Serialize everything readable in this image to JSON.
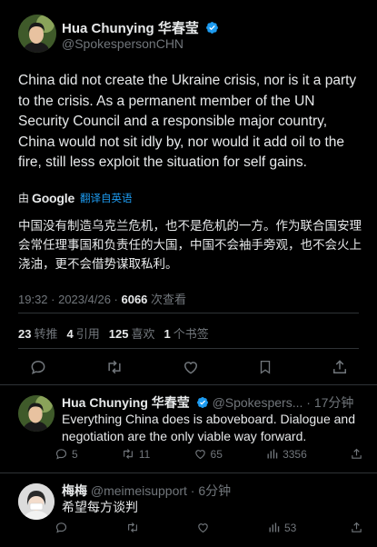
{
  "main_tweet": {
    "author_name": "Hua Chunying 华春莹",
    "handle": "@SpokespersonCHN",
    "text_en": "China did not create the Ukraine crisis, nor is it a party to the crisis. As a permanent member of the UN Security Council and a responsible major country, China would not sit idly by, nor would it add oil to the fire, still less exploit the situation for self gains.",
    "translated_by_prefix": "由",
    "translated_by_brand": "Google",
    "translate_label": "翻译自英语",
    "text_zh": "中国没有制造乌克兰危机，也不是危机的一方。作为联合国安理会常任理事国和负责任的大国，中国不会袖手旁观，也不会火上浇油，更不会借势谋取私利。",
    "time": "19:32 · 2023/4/26 · ",
    "views_count": "6066",
    "views_label": " 次查看",
    "stats": {
      "retweets_count": "23",
      "retweets_label": "转推",
      "quotes_count": "4",
      "quotes_label": "引用",
      "likes_count": "125",
      "likes_label": "喜欢",
      "bookmarks_count": "1",
      "bookmarks_label": "个书签"
    }
  },
  "replies": [
    {
      "author_name": "Hua Chunying 华春莹",
      "handle_time": "@Spokespers... · 17分钟",
      "text": "Everything China does is aboveboard. Dialogue and negotiation are the only viable way forward.",
      "reply_count": "5",
      "retweet_count": "11",
      "like_count": "65",
      "view_count": "3356"
    },
    {
      "author_name": "梅梅",
      "handle_time": "@meimeisupport · 6分钟",
      "text": "希望每方谈判",
      "reply_count": "",
      "retweet_count": "",
      "like_count": "",
      "view_count": "53"
    }
  ],
  "colors": {
    "background": "#000000",
    "text": "#e7e9ea",
    "muted": "#71767b",
    "accent": "#1d9bf0",
    "divider": "#2f3336"
  },
  "icons": [
    "verified-badge-icon",
    "google-logo",
    "reply-icon",
    "retweet-icon",
    "like-icon",
    "bookmark-icon",
    "share-icon",
    "views-icon"
  ]
}
